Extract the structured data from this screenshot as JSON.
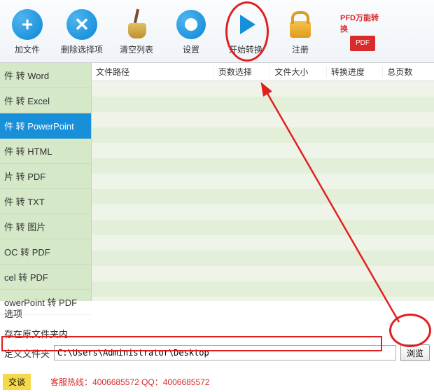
{
  "toolbar": {
    "add": "加文件",
    "remove": "删除选择项",
    "clear": "清空列表",
    "settings": "设置",
    "start": "开始转换",
    "register": "注册",
    "brand": "PFD万能转换",
    "brand_badge": "PDF"
  },
  "sidebar": {
    "items": [
      "件 转 Word",
      "件 转 Excel",
      "件 转 PowerPoint",
      "件 转 HTML",
      "片 转 PDF",
      "件 转 TXT",
      "件 转 图片",
      "OC 转 PDF",
      "cel 转 PDF",
      "owerPoint 转 PDF"
    ],
    "selected_index": 2
  },
  "table": {
    "headers": [
      "文件路径",
      "页数选择",
      "文件大小",
      "转换进度",
      "总页数"
    ]
  },
  "options": {
    "title": "选项",
    "save_in_source": "存在原文件夹内",
    "custom_folder_label": "定义文件夹",
    "custom_folder_path": "C:\\Users\\Administrator\\Desktop",
    "browse": "浏览"
  },
  "footer": {
    "chat": "交谈",
    "hotline": "客服热线：4006685572 QQ：4006685572"
  }
}
